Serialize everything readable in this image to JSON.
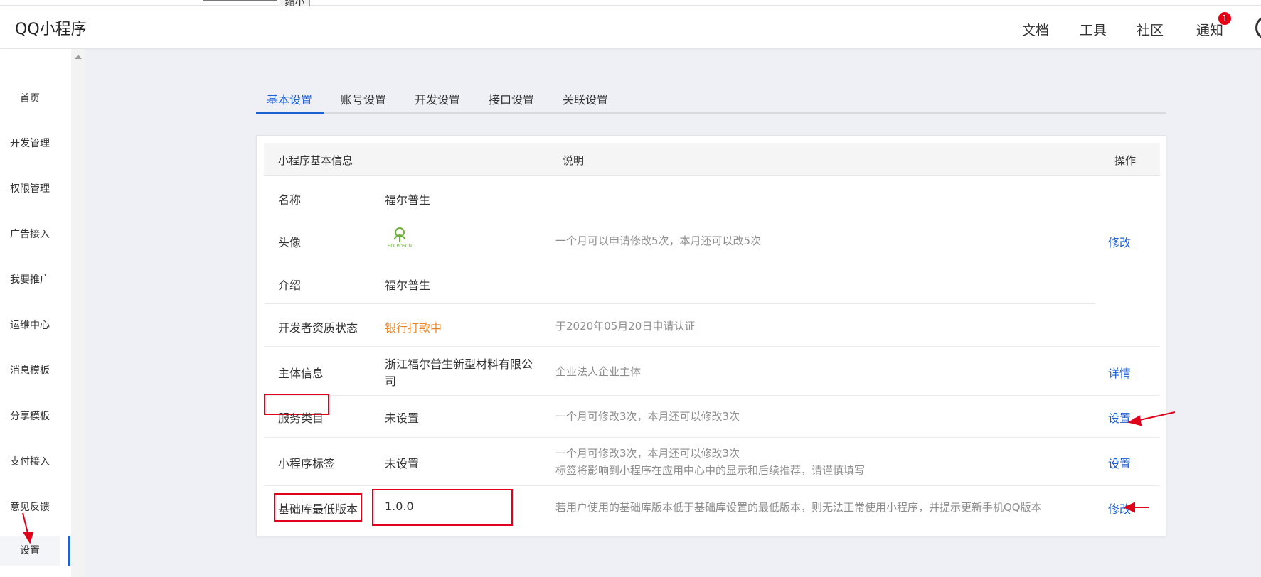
{
  "toolbar": {
    "zoom_out_label": "缩小"
  },
  "header": {
    "brand": "QQ小程序",
    "nav": [
      "文档",
      "工具",
      "社区",
      "通知"
    ],
    "notify_count": "1"
  },
  "sidebar": {
    "items": [
      "首页",
      "开发管理",
      "权限管理",
      "广告接入",
      "我要推广",
      "运维中心",
      "消息模板",
      "分享模板",
      "支付接入",
      "意见反馈",
      "设置"
    ],
    "active": "设置"
  },
  "tabs": [
    "基本设置",
    "账号设置",
    "开发设置",
    "接口设置",
    "关联设置"
  ],
  "table": {
    "headers": [
      "小程序基本信息",
      "说明",
      "操作"
    ],
    "rows": [
      {
        "label": "名称",
        "value": "福尔普生"
      },
      {
        "label": "头像",
        "logo_text": "HOLPOSON",
        "desc": "一个月可以申请修改5次，本月还可以改5次",
        "action": "修改"
      },
      {
        "label": "介绍",
        "value": "福尔普生"
      },
      {
        "label": "开发者资质状态",
        "value": "银行打款中",
        "desc": "于2020年05月20日申请认证"
      },
      {
        "label": "主体信息",
        "value_line1": "浙江福尔普生新型材料有限公",
        "value_line2": "司",
        "desc": "企业法人企业主体",
        "action": "详情"
      },
      {
        "label": "服务类目",
        "value": "未设置",
        "desc": "一个月可修改3次，本月还可以修改3次",
        "action": "设置"
      },
      {
        "label": "小程序标签",
        "value": "未设置",
        "desc_line1": "一个月可修改3次，本月还可以修改3次",
        "desc_line2": "标签将影响到小程序在应用中心中的显示和后续推荐，请谨慎填写",
        "action": "设置"
      },
      {
        "label": "基础库最低版本",
        "value": "1.0.0",
        "desc": "若用户使用的基础库版本低于基础库设置的最低版本，则无法正常使用小程序，并提示更新手机QQ版本",
        "action": "修改"
      }
    ]
  },
  "colors": {
    "accent": "#1c5fd1",
    "annotation_red": "#e0001b",
    "status_orange": "#e8872a",
    "badge_red": "#e60012"
  }
}
